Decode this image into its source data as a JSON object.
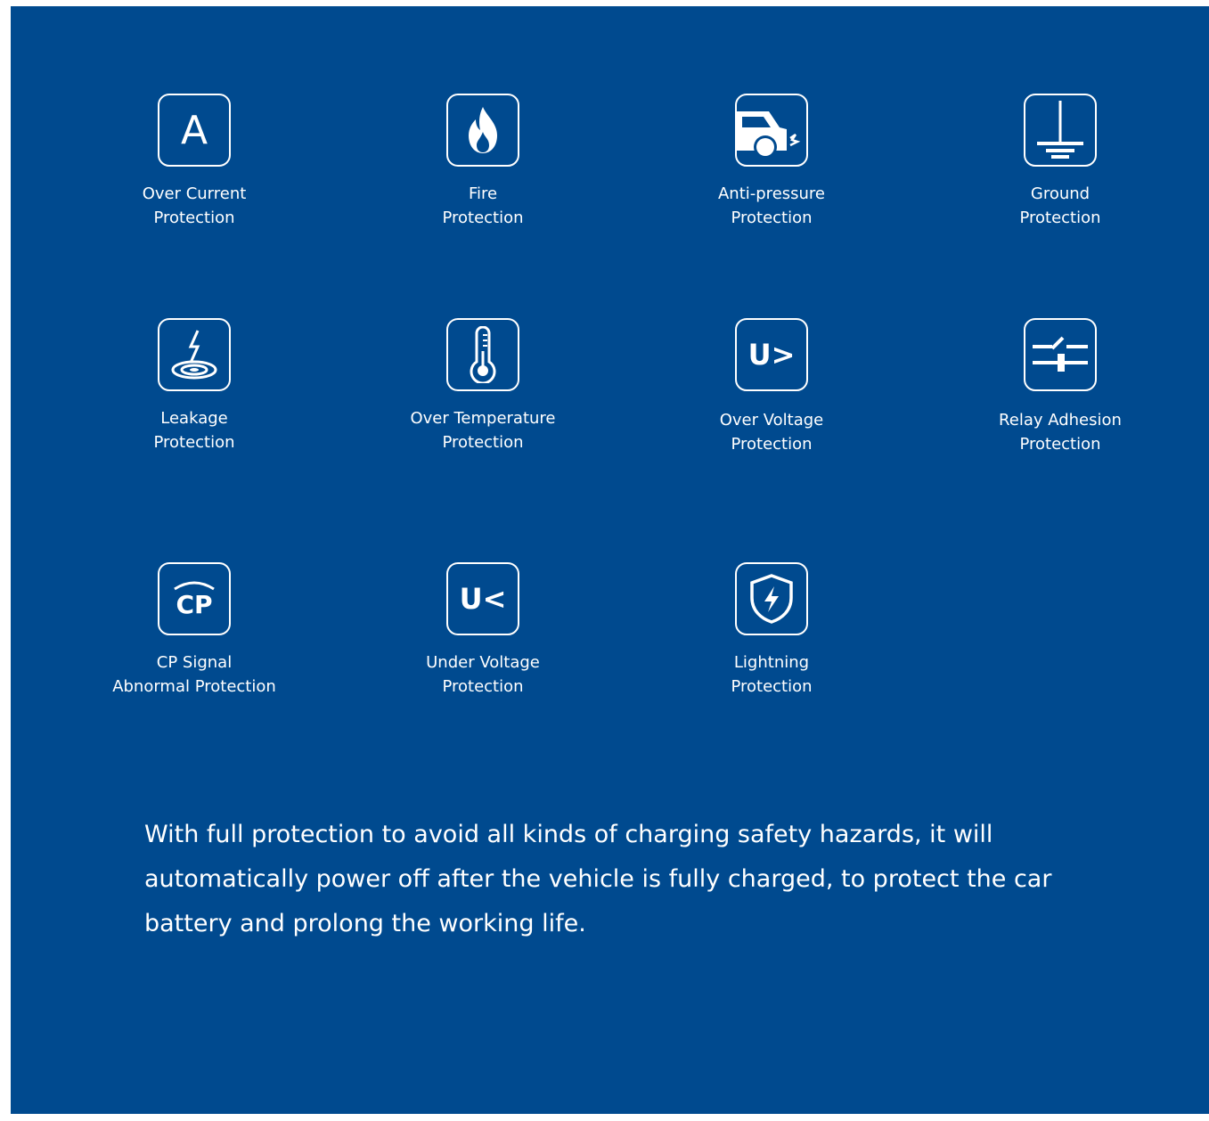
{
  "colors": {
    "background": "#004a8f",
    "foreground": "#ffffff"
  },
  "protections": [
    {
      "icon": "ampere-icon",
      "glyph": "A",
      "line1": "Over Current",
      "line2": "Protection"
    },
    {
      "icon": "flame-icon",
      "line1": "Fire",
      "line2": "Protection"
    },
    {
      "icon": "car-collision-icon",
      "line1": "Anti-pressure",
      "line2": "Protection"
    },
    {
      "icon": "ground-icon",
      "line1": "Ground",
      "line2": "Protection"
    },
    {
      "icon": "leakage-icon",
      "line1": "Leakage",
      "line2": "Protection"
    },
    {
      "icon": "thermometer-icon",
      "line1": "Over Temperature",
      "line2": "Protection"
    },
    {
      "icon": "over-voltage-icon",
      "glyph": "U>",
      "line1": "Over Voltage",
      "line2": "Protection"
    },
    {
      "icon": "relay-icon",
      "line1": "Relay Adhesion",
      "line2": "Protection"
    },
    {
      "icon": "cp-signal-icon",
      "glyph": "CP",
      "line1": "CP Signal",
      "line2": "Abnormal Protection"
    },
    {
      "icon": "under-voltage-icon",
      "glyph": "U<",
      "line1": "Under Voltage",
      "line2": "Protection"
    },
    {
      "icon": "lightning-shield-icon",
      "line1": "Lightning",
      "line2": "Protection"
    }
  ],
  "description": "With full protection to avoid all kinds of charging safety hazards, it will automatically power off after the vehicle is fully charged, to protect the car battery and prolong the working life."
}
